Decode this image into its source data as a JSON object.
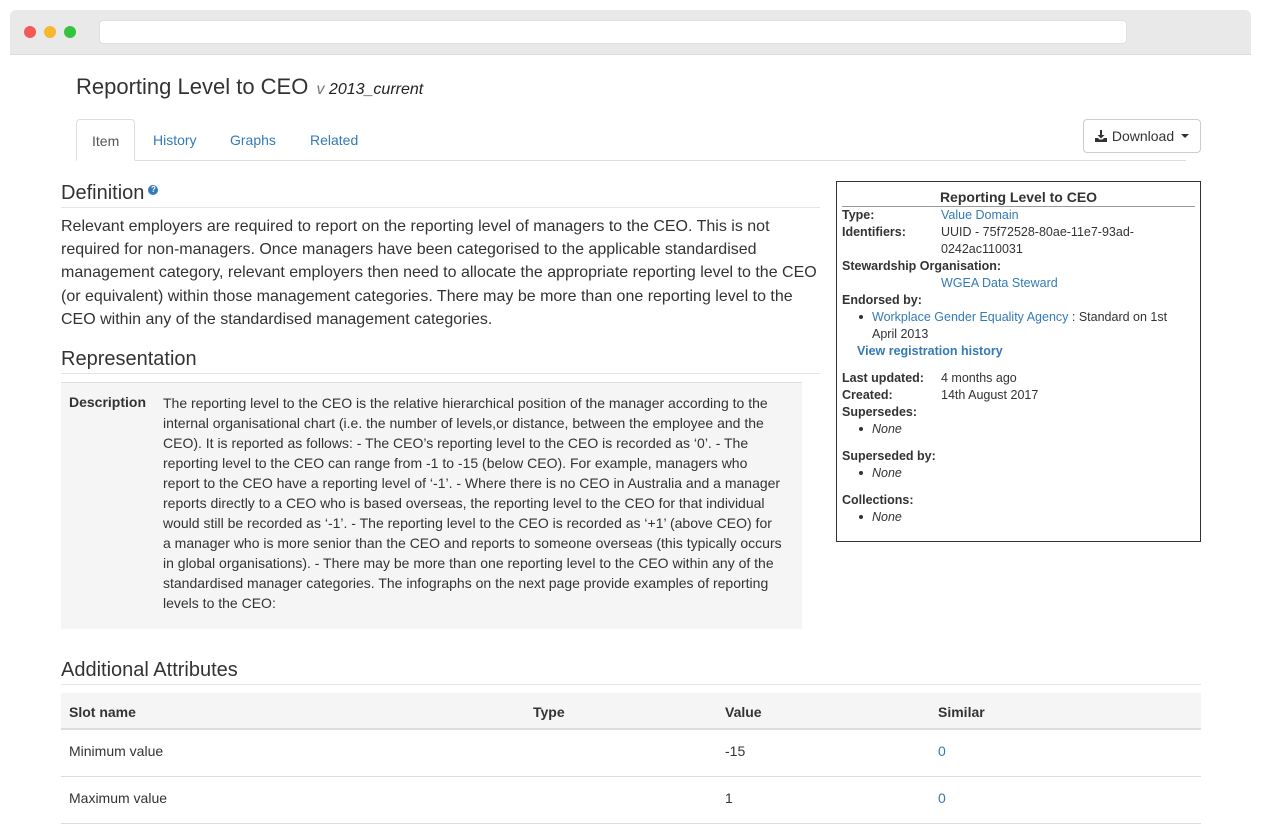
{
  "page": {
    "title": "Reporting Level to CEO",
    "version_prefix": "v",
    "version": "2013_current"
  },
  "tabs": [
    {
      "label": "Item",
      "active": true
    },
    {
      "label": "History"
    },
    {
      "label": "Graphs"
    },
    {
      "label": "Related"
    }
  ],
  "download_label": "Download",
  "definition": {
    "heading": "Definition",
    "text": "Relevant employers are required to report on the reporting level of managers to the CEO. This is not required for non-managers. Once managers have been categorised to the applicable standardised management category, relevant employers then need to allocate the appropriate reporting level to the CEO (or equivalent) within those management categories. There may be more than one reporting level to the CEO within any of the standardised management categories."
  },
  "representation": {
    "heading": "Representation",
    "description_label": "Description",
    "description": "The reporting level to the CEO is the relative hierarchical position of the manager according to the internal organisational chart (i.e. the number of levels,or distance, between the employee and the CEO). It is reported as follows: - The CEO’s reporting level to the CEO is recorded as ‘0’. - The reporting level to the CEO can range from -1 to -15 (below CEO). For example, managers who report to the CEO have a reporting level of ‘-1’. - Where there is no CEO in Australia and a manager reports directly to a CEO who is based overseas, the reporting level to the CEO for that individual would still be recorded as ‘-1’. - The reporting level to the CEO is recorded as ‘+1’ (above CEO) for a manager who is more senior than the CEO and reports to someone overseas (this typically occurs in global organisations). - There may be more than one reporting level to the CEO within any of the standardised manager categories. The infographs on the next page provide examples of reporting levels to the CEO:"
  },
  "side_panel": {
    "title": "Reporting Level to CEO",
    "type_label": "Type:",
    "type_value": "Value Domain",
    "identifiers_label": "Identifiers:",
    "identifiers_line1": "UUID - 75f72528-80ae-11e7-93ad-",
    "identifiers_line2": "0242ac110031",
    "stewardship_label": "Stewardship Organisation:",
    "stewardship_value": "WGEA Data Steward",
    "endorsed_label": "Endorsed by:",
    "endorsed_org": "Workplace Gender Equality Agency",
    "endorsed_status_line1": " : Standard on 1st",
    "endorsed_status_line2": "April 2013",
    "registration_link": "View registration history",
    "last_updated_label": "Last updated:",
    "last_updated_value": "4 months ago",
    "created_label": "Created:",
    "created_value": "14th August 2017",
    "supersedes_label": "Supersedes:",
    "supersedes_value": "None",
    "superseded_by_label": "Superseded by:",
    "superseded_by_value": "None",
    "collections_label": "Collections:",
    "collections_value": "None"
  },
  "additional": {
    "heading": "Additional Attributes",
    "columns": [
      "Slot name",
      "Type",
      "Value",
      "Similar"
    ],
    "rows": [
      {
        "slot": "Minimum value",
        "type": "",
        "value": "-15",
        "similar": "0"
      },
      {
        "slot": "Maximum value",
        "type": "",
        "value": "1",
        "similar": "0"
      }
    ]
  }
}
